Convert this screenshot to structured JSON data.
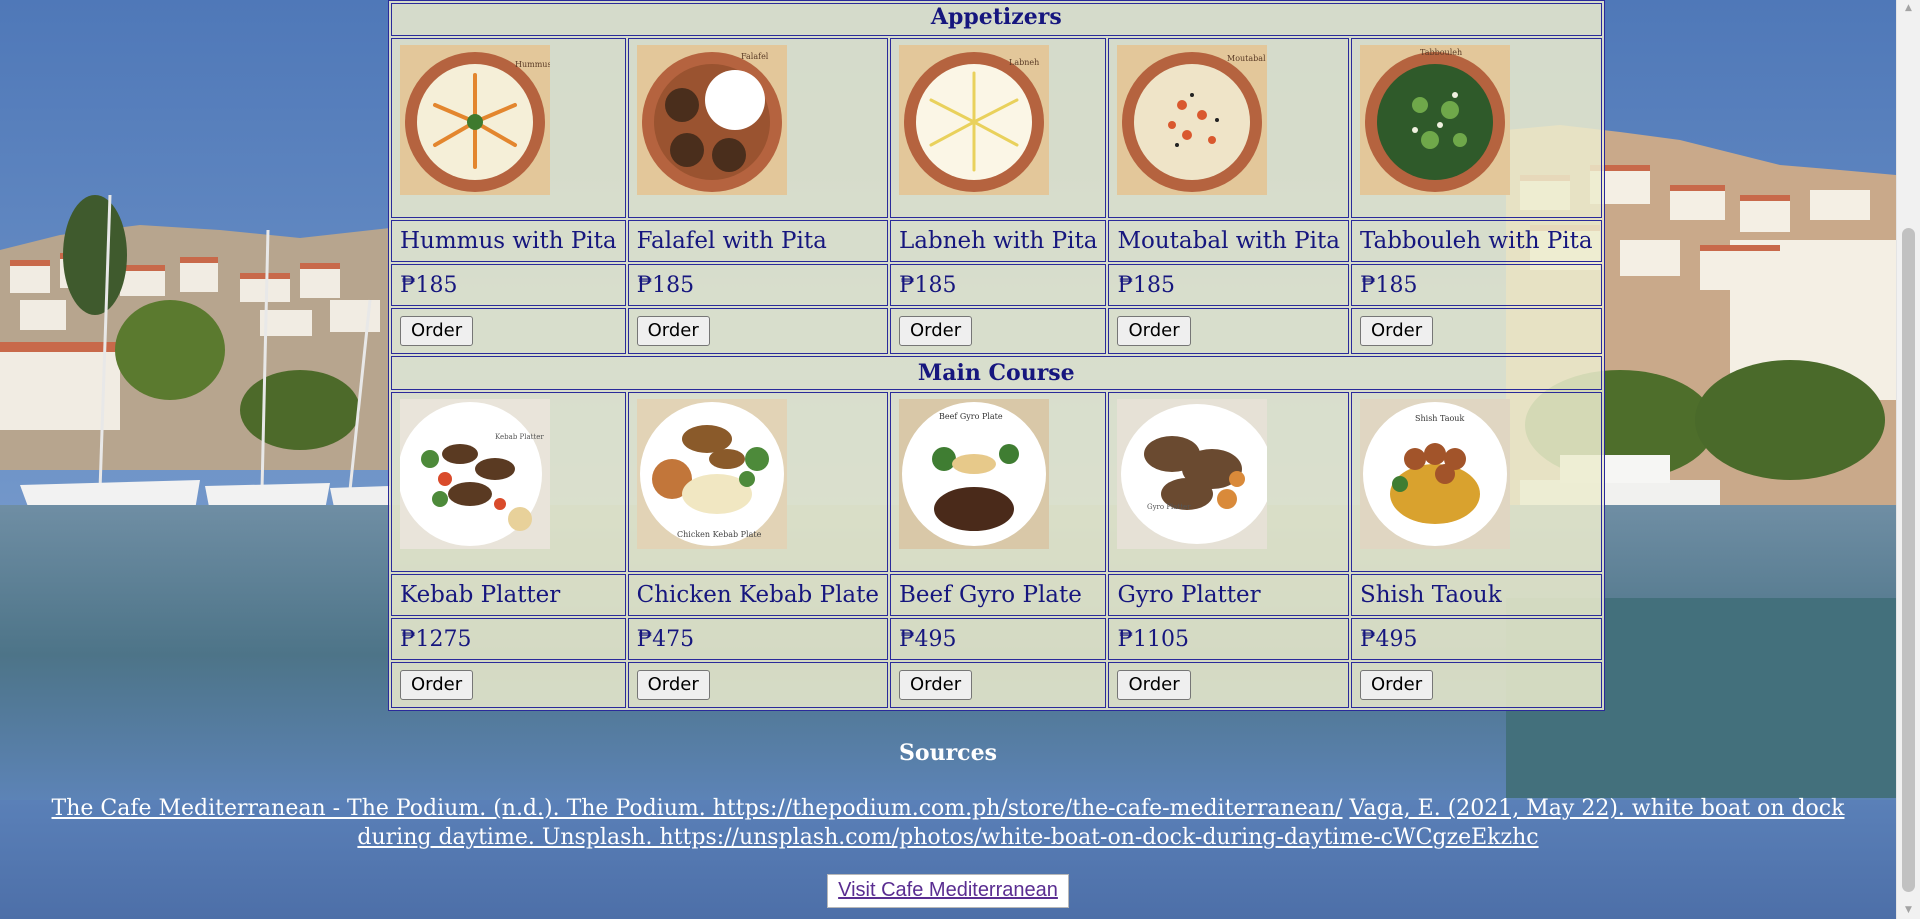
{
  "sections": [
    {
      "title": "Appetizers",
      "items": [
        {
          "name": "Hummus with Pita",
          "price": "₱185",
          "order": "Order",
          "image": "hummus-plate",
          "plate_label": "Hummus"
        },
        {
          "name": "Falafel with Pita",
          "price": "₱185",
          "order": "Order",
          "image": "falafel-plate",
          "plate_label": "Falafel"
        },
        {
          "name": "Labneh with Pita",
          "price": "₱185",
          "order": "Order",
          "image": "labneh-plate",
          "plate_label": "Labneh"
        },
        {
          "name": "Moutabal with Pita",
          "price": "₱185",
          "order": "Order",
          "image": "moutabal-plate",
          "plate_label": "Moutabal"
        },
        {
          "name": "Tabbouleh with Pita",
          "price": "₱185",
          "order": "Order",
          "image": "tabbouleh-plate",
          "plate_label": "Tabbouleh"
        }
      ]
    },
    {
      "title": "Main Course",
      "items": [
        {
          "name": "Kebab Platter",
          "price": "₱1275",
          "order": "Order",
          "image": "kebab-platter",
          "plate_label": "Kebab Platter"
        },
        {
          "name": "Chicken Kebab Plate",
          "price": "₱475",
          "order": "Order",
          "image": "chicken-kebab-plate",
          "plate_label": "Chicken Kebab Plate"
        },
        {
          "name": "Beef Gyro Plate",
          "price": "₱495",
          "order": "Order",
          "image": "beef-gyro-plate",
          "plate_label": "Beef Gyro Plate"
        },
        {
          "name": "Gyro Platter",
          "price": "₱1105",
          "order": "Order",
          "image": "gyro-platter",
          "plate_label": "Gyro Platter"
        },
        {
          "name": "Shish Taouk",
          "price": "₱495",
          "order": "Order",
          "image": "shish-taouk-plate",
          "plate_label": "Shish Taouk"
        }
      ]
    }
  ],
  "sources": {
    "heading": "Sources",
    "citation_1": "The Cafe Mediterranean - The Podium. (n.d.). The Podium. https://thepodium.com.ph/store/the-cafe-mediterranean/",
    "citation_2": "Vaga, E. (2021, May 22). white boat on dock during daytime. Unsplash. https://unsplash.com/photos/white-boat-on-dock-during-daytime-cWCgzeEkzhc"
  },
  "visit_button": "Visit Cafe Mediterranean",
  "colors": {
    "table_border": "#2a2a9a",
    "text": "#16167e",
    "table_bg": "#ececce",
    "sky": "#6a8fc7",
    "sea": "#5c8096",
    "link_visited": "#5a2d91"
  },
  "icons": {
    "scroll_up": "scroll-up-arrow-icon",
    "scroll_down": "scroll-down-arrow-icon"
  }
}
